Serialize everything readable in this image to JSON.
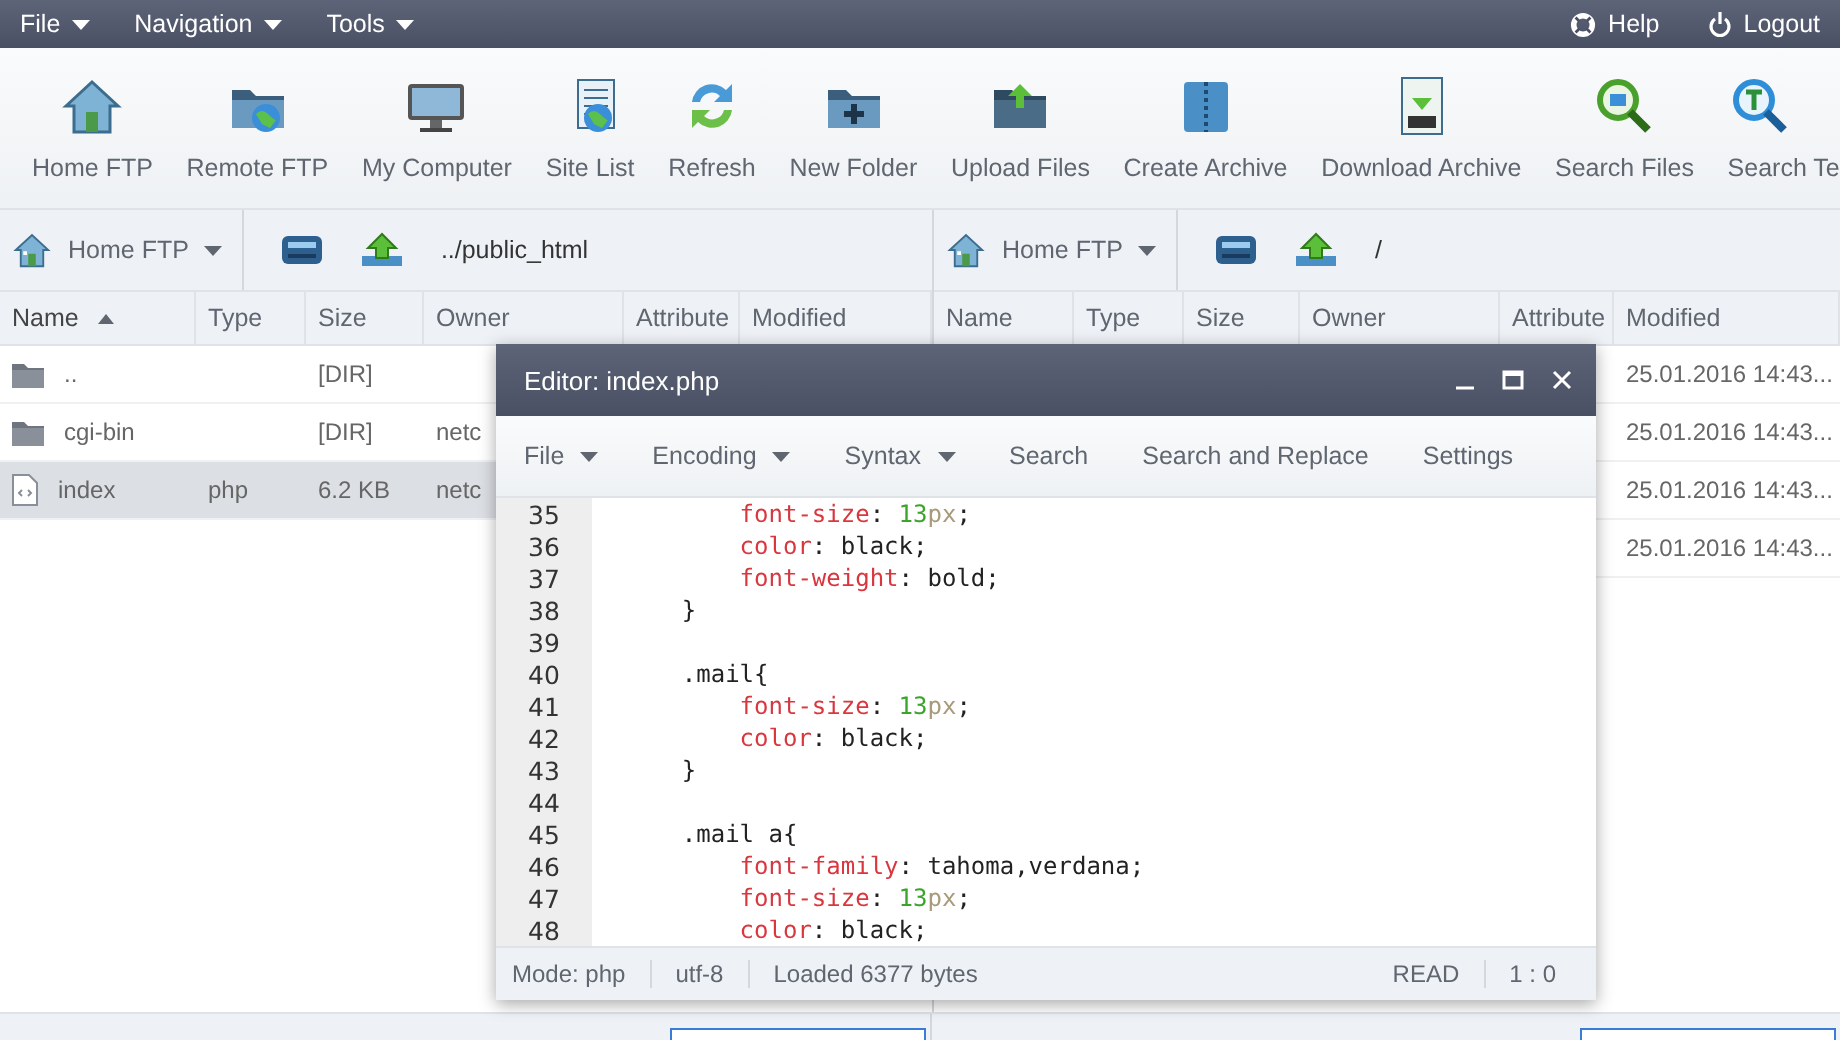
{
  "menu_bar": {
    "menus": [
      {
        "label": "File"
      },
      {
        "label": "Navigation"
      },
      {
        "label": "Tools"
      }
    ],
    "right": [
      {
        "label": "Help"
      },
      {
        "label": "Logout"
      }
    ]
  },
  "toolbar": [
    {
      "label": "Home FTP"
    },
    {
      "label": "Remote FTP"
    },
    {
      "label": "My Computer"
    },
    {
      "label": "Site List"
    },
    {
      "label": "Refresh"
    },
    {
      "label": "New Folder"
    },
    {
      "label": "Upload Files"
    },
    {
      "label": "Create Archive"
    },
    {
      "label": "Download Archive"
    },
    {
      "label": "Search Files"
    },
    {
      "label": "Search Te"
    }
  ],
  "panels": [
    {
      "site": "Home FTP",
      "path": "../public_html",
      "columns": [
        {
          "label": "Name",
          "sorted": true
        },
        {
          "label": "Type",
          "sorted": false
        },
        {
          "label": "Size",
          "sorted": false
        },
        {
          "label": "Owner",
          "sorted": false
        },
        {
          "label": "Attribute",
          "sorted": false
        },
        {
          "label": "Modified",
          "sorted": false
        }
      ],
      "rows": [
        {
          "kind": "folder",
          "name": "..",
          "size": "[DIR]",
          "selected": false
        },
        {
          "kind": "folder",
          "name": "cgi-bin",
          "size": "[DIR]",
          "owner": "netc",
          "selected": false
        },
        {
          "kind": "file",
          "name": "index",
          "type": "php",
          "size": "6.2 KB",
          "owner": "netc",
          "selected": true
        }
      ]
    },
    {
      "site": "Home FTP",
      "path": "/",
      "columns": [
        {
          "label": "Name",
          "sorted": false
        },
        {
          "label": "Type",
          "sorted": false
        },
        {
          "label": "Size",
          "sorted": false
        },
        {
          "label": "Owner",
          "sorted": false
        },
        {
          "label": "Attribute",
          "sorted": false
        },
        {
          "label": "Modified",
          "sorted": false
        }
      ],
      "rows": [
        {
          "kind": "blank",
          "modified": "25.01.2016 14:43...",
          "selected": false
        },
        {
          "kind": "blank",
          "modified": "25.01.2016 14:43...",
          "selected": false
        },
        {
          "kind": "blank",
          "modified": "25.01.2016 14:43...",
          "selected": false
        },
        {
          "kind": "blank",
          "modified": "25.01.2016 14:43...",
          "selected": false
        }
      ]
    }
  ],
  "editor": {
    "title": "Editor: index.php",
    "menus": [
      {
        "label": "File",
        "dropdown": true
      },
      {
        "label": "Encoding",
        "dropdown": true
      },
      {
        "label": "Syntax",
        "dropdown": true
      },
      {
        "label": "Search",
        "dropdown": false
      },
      {
        "label": "Search and Replace",
        "dropdown": false
      },
      {
        "label": "Settings",
        "dropdown": false
      }
    ],
    "lines": [
      {
        "number": "35",
        "tokens": [
          {
            "kind": "property",
            "text": "        font-size"
          },
          {
            "kind": "plain",
            "text": ": "
          },
          {
            "kind": "number",
            "text": "13"
          },
          {
            "kind": "unit",
            "text": "px"
          },
          {
            "kind": "plain",
            "text": ";"
          }
        ]
      },
      {
        "number": "36",
        "tokens": [
          {
            "kind": "property",
            "text": "        color"
          },
          {
            "kind": "plain",
            "text": ": black;"
          }
        ]
      },
      {
        "number": "37",
        "tokens": [
          {
            "kind": "property",
            "text": "        font-weight"
          },
          {
            "kind": "plain",
            "text": ": bold;"
          }
        ]
      },
      {
        "number": "38",
        "tokens": [
          {
            "kind": "plain",
            "text": "    }"
          }
        ]
      },
      {
        "number": "39"
      },
      {
        "number": "40",
        "tokens": [
          {
            "kind": "plain",
            "text": "    .mail{"
          }
        ]
      },
      {
        "number": "41",
        "tokens": [
          {
            "kind": "property",
            "text": "        font-size"
          },
          {
            "kind": "plain",
            "text": ": "
          },
          {
            "kind": "number",
            "text": "13"
          },
          {
            "kind": "unit",
            "text": "px"
          },
          {
            "kind": "plain",
            "text": ";"
          }
        ]
      },
      {
        "number": "42",
        "tokens": [
          {
            "kind": "property",
            "text": "        color"
          },
          {
            "kind": "plain",
            "text": ": black;"
          }
        ]
      },
      {
        "number": "43",
        "tokens": [
          {
            "kind": "plain",
            "text": "    }"
          }
        ]
      },
      {
        "number": "44"
      },
      {
        "number": "45",
        "tokens": [
          {
            "kind": "plain",
            "text": "    .mail a{"
          }
        ]
      },
      {
        "number": "46",
        "tokens": [
          {
            "kind": "property",
            "text": "        font-family"
          },
          {
            "kind": "plain",
            "text": ": tahoma,verdana;"
          }
        ]
      },
      {
        "number": "47",
        "tokens": [
          {
            "kind": "property",
            "text": "        font-size"
          },
          {
            "kind": "plain",
            "text": ": "
          },
          {
            "kind": "number",
            "text": "13"
          },
          {
            "kind": "unit",
            "text": "px"
          },
          {
            "kind": "plain",
            "text": ";"
          }
        ]
      },
      {
        "number": "48",
        "tokens": [
          {
            "kind": "property",
            "text": "        color"
          },
          {
            "kind": "plain",
            "text": ": black;"
          }
        ]
      }
    ],
    "status": {
      "mode": "Mode: php",
      "encoding": "utf-8",
      "message": "Loaded 6377 bytes",
      "access": "READ",
      "position": "1 : 0"
    }
  }
}
